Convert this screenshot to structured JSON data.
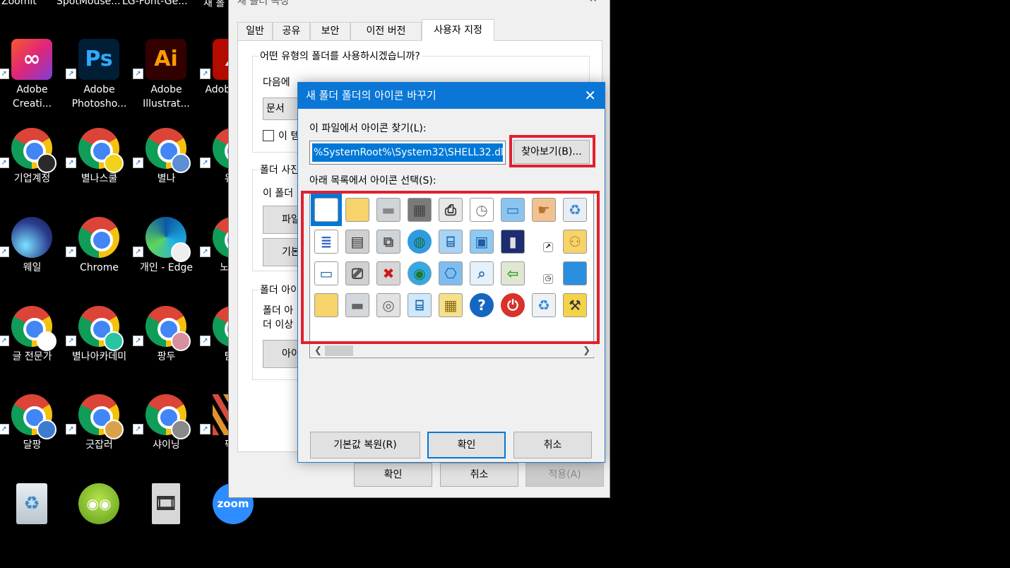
{
  "desktop": {
    "top_labels": [
      "Zoomlt",
      "SpotMouse...",
      "LG-Font-Ge...",
      "새 폴"
    ],
    "icons": [
      {
        "label": "Adobe Creati...",
        "type": "adobe-cc",
        "shortcut": true
      },
      {
        "label": "Adobe Photosho...",
        "type": "photoshop",
        "shortcut": true
      },
      {
        "label": "Adobe Illustrat...",
        "type": "illustrator",
        "shortcut": true
      },
      {
        "label": "Adob Acrob",
        "type": "acrobat",
        "shortcut": true
      },
      {
        "label": "기업계정",
        "type": "chrome",
        "badge_color": "#2a2a2a"
      },
      {
        "label": "별나스쿨",
        "type": "chrome",
        "badge_color": "#f2d21b"
      },
      {
        "label": "별나",
        "type": "chrome",
        "badge_color": "#5b8fd6"
      },
      {
        "label": "유별",
        "type": "chrome",
        "badge_color": "#6b5a3a"
      },
      {
        "label": "웨일",
        "type": "whale"
      },
      {
        "label": "Chrome",
        "type": "chrome"
      },
      {
        "label": "개인 - Edge",
        "type": "edge"
      },
      {
        "label": "노션전",
        "type": "chrome",
        "badge_color": "#cccccc"
      },
      {
        "label": "글 전문가",
        "type": "chrome",
        "badge_color": "#ffffff"
      },
      {
        "label": "별나아카데미",
        "type": "chrome",
        "badge_color": "#27c6a3"
      },
      {
        "label": "팡두",
        "type": "chrome",
        "badge_color": "#d88fa0"
      },
      {
        "label": "탐니",
        "type": "chrome",
        "badge_color": "#4aa0e0"
      },
      {
        "label": "달팡",
        "type": "chrome",
        "badge_color": "#3c7bd0"
      },
      {
        "label": "긋잡러",
        "type": "chrome",
        "badge_color": "#d9a24a"
      },
      {
        "label": "샤이닝",
        "type": "chrome",
        "badge_color": "#8a8a8a"
      },
      {
        "label": "픽픽",
        "type": "picpick"
      },
      {
        "label": "",
        "type": "recycle-bin"
      },
      {
        "label": "",
        "type": "frog"
      },
      {
        "label": "",
        "type": "movie-maker"
      },
      {
        "label": "",
        "type": "zoom",
        "text": "zoom"
      }
    ]
  },
  "props_window": {
    "title": "새 폴더 속성",
    "tabs": [
      "일반",
      "공유",
      "보안",
      "이전 버전",
      "사용자 지정"
    ],
    "active_tab": 4,
    "group1_title": "어떤 유형의 폴더를 사용하시겠습니까?",
    "group1_line": "다음에",
    "select_value": "문서",
    "checkbox_label": "이 템",
    "group2_title": "폴더 사진",
    "group2_line": "이 폴더",
    "btn_file": "파일",
    "btn_default": "기본",
    "group3_title": "폴더 아이",
    "group3_line1": "폴더 아",
    "group3_line2": "더 이상",
    "btn_icon": "아이",
    "ok": "확인",
    "cancel": "취소",
    "apply": "적용(A)"
  },
  "dialog": {
    "title": "새 폴더 폴더의 아이콘 바꾸기",
    "find_label": "이 파일에서 아이콘 찾기(L):",
    "path_value": "%SystemRoot%\\System32\\SHELL32.dll",
    "browse": "찾아보기(B)...",
    "select_label": "아래 목록에서 아이콘 선택(S):",
    "restore": "기본값 복원(R)",
    "ok": "확인",
    "cancel": "취소",
    "icons": [
      [
        "blank-document-icon",
        "folder-icon",
        "drive-icon",
        "memory-chip-icon",
        "printer-icon",
        "clock-document-icon",
        "window-app-icon",
        "handshake-icon",
        "recycle-bin-full-icon"
      ],
      [
        "text-document-icon",
        "network-drive-icon",
        "network-drive-share-icon",
        "globe-icon",
        "network-computer-icon",
        "control-panel-icon",
        "dos-window-icon",
        "shortcut-arrow-icon",
        "shared-folder-icon"
      ],
      [
        "blank-window-icon",
        "floppy-drive-icon",
        "disconnected-drive-icon",
        "web-globe-mouse-icon",
        "network-icon",
        "search-icon",
        "move-folder-icon",
        "clock-small-icon",
        "desktop-blue-icon"
      ],
      [
        "folder-closed-icon",
        "hard-drive-icon",
        "cd-drive-icon",
        "monitor-icon",
        "app-grid-folder-icon",
        "help-icon",
        "power-icon",
        "recycle-bin-empty-icon",
        "folder-tools-icon"
      ]
    ]
  },
  "colors": {
    "accent": "#0078d7",
    "title_bar": "#0a76d6",
    "highlight_red": "#e0202e"
  }
}
